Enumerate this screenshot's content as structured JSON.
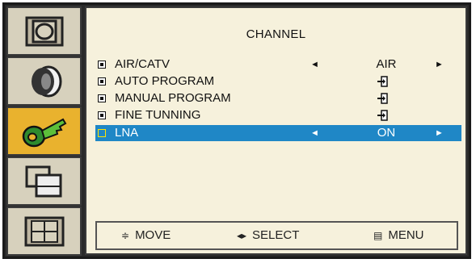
{
  "menu": {
    "title": "CHANNEL",
    "items": [
      {
        "label": "AIR/CATV",
        "value": "AIR",
        "control": "arrows",
        "selected": false
      },
      {
        "label": "AUTO PROGRAM",
        "control": "enter-icon",
        "selected": false
      },
      {
        "label": "MANUAL PROGRAM",
        "control": "enter-icon",
        "selected": false
      },
      {
        "label": "FINE TUNNING",
        "control": "enter-icon",
        "selected": false
      },
      {
        "label": "LNA",
        "value": "ON",
        "control": "arrows",
        "selected": true
      }
    ]
  },
  "sidebar": {
    "tabs": [
      {
        "name": "picture-icon",
        "active": false
      },
      {
        "name": "sound-icon",
        "active": false
      },
      {
        "name": "setup-key-icon",
        "active": true
      },
      {
        "name": "pip-icon",
        "active": false
      },
      {
        "name": "function-icon",
        "active": false
      }
    ]
  },
  "nav": {
    "move_icon": "≑",
    "move_label": "MOVE",
    "select_icon": "◂▸",
    "select_label": "SELECT",
    "menu_icon": "▤",
    "menu_label": "MENU"
  },
  "glyphs": {
    "left_arrow": "◄",
    "right_arrow": "►"
  },
  "colors": {
    "selection": "#1f87c6",
    "active_tab": "#e9b22e",
    "panel_bg": "#f6f1dc",
    "tab_bg": "#d7d1bd"
  }
}
